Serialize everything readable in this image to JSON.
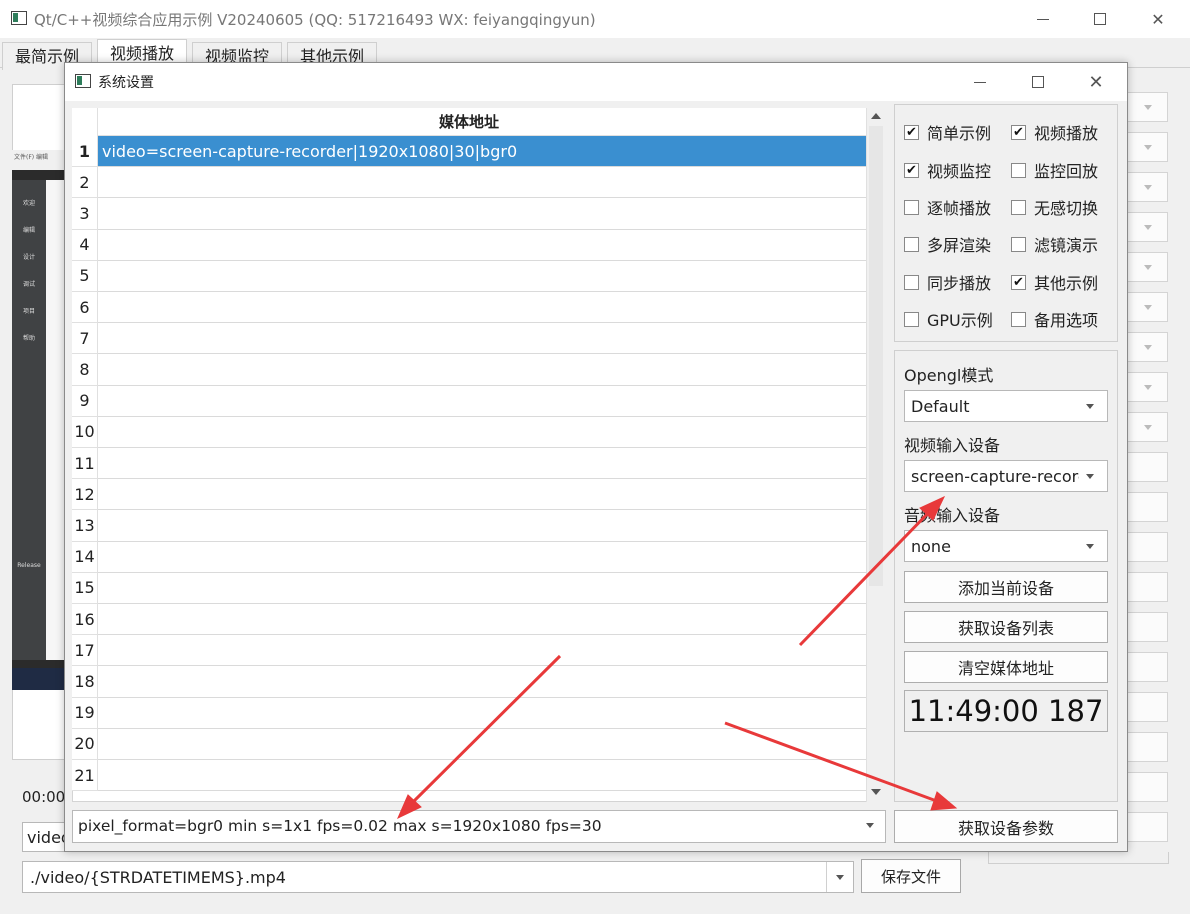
{
  "main_window": {
    "title": "Qt/C++视频综合应用示例 V20240605 (QQ: 517216493 WX: feiyangqingyun)",
    "tabs": [
      {
        "label": "最简示例"
      },
      {
        "label": "视频播放"
      },
      {
        "label": "视频监控"
      },
      {
        "label": "其他示例"
      }
    ],
    "active_tab": "视频播放",
    "time_label": "00:00",
    "left_combo_value": "video",
    "save_path": "./video/{STRDATETIMEMS}.mp4",
    "save_button": "保存文件",
    "preview_menu": "文件(F)  编辑",
    "preview_sidebar": [
      "欢迎",
      "编辑",
      "设计",
      "调试",
      "项目",
      "帮助"
    ],
    "preview_release": "Release"
  },
  "dialog": {
    "title": "系统设置",
    "table": {
      "column_header": "媒体地址",
      "rows": [
        {
          "num": "1",
          "value": "video=screen-capture-recorder|1920x1080|30|bgr0",
          "selected": true
        },
        {
          "num": "2",
          "value": ""
        },
        {
          "num": "3",
          "value": ""
        },
        {
          "num": "4",
          "value": ""
        },
        {
          "num": "5",
          "value": ""
        },
        {
          "num": "6",
          "value": ""
        },
        {
          "num": "7",
          "value": ""
        },
        {
          "num": "8",
          "value": ""
        },
        {
          "num": "9",
          "value": ""
        },
        {
          "num": "10",
          "value": ""
        },
        {
          "num": "11",
          "value": ""
        },
        {
          "num": "12",
          "value": ""
        },
        {
          "num": "13",
          "value": ""
        },
        {
          "num": "14",
          "value": ""
        },
        {
          "num": "15",
          "value": ""
        },
        {
          "num": "16",
          "value": ""
        },
        {
          "num": "17",
          "value": ""
        },
        {
          "num": "18",
          "value": ""
        },
        {
          "num": "19",
          "value": ""
        },
        {
          "num": "20",
          "value": ""
        },
        {
          "num": "21",
          "value": ""
        }
      ]
    },
    "checkboxes": [
      {
        "label": "简单示例",
        "checked": true
      },
      {
        "label": "视频播放",
        "checked": true
      },
      {
        "label": "视频监控",
        "checked": true
      },
      {
        "label": "监控回放",
        "checked": false
      },
      {
        "label": "逐帧播放",
        "checked": false
      },
      {
        "label": "无感切换",
        "checked": false
      },
      {
        "label": "多屏渲染",
        "checked": false
      },
      {
        "label": "滤镜演示",
        "checked": false
      },
      {
        "label": "同步播放",
        "checked": false
      },
      {
        "label": "其他示例",
        "checked": true
      },
      {
        "label": "GPU示例",
        "checked": false
      },
      {
        "label": "备用选项",
        "checked": false
      }
    ],
    "opengl_label": "Opengl模式",
    "opengl_value": "Default",
    "video_device_label": "视频输入设备",
    "video_device_value": "screen-capture-recorder",
    "audio_device_label": "音频输入设备",
    "audio_device_value": "none",
    "btn_add_device": "添加当前设备",
    "btn_get_devices": "获取设备列表",
    "btn_clear_urls": "清空媒体地址",
    "clock": "11:49:00 187",
    "device_params": "pixel_format=bgr0 min s=1x1 fps=0.02 max s=1920x1080 fps=30",
    "btn_get_params": "获取设备参数"
  },
  "colors": {
    "selection": "#3a8fd0",
    "annotation_arrow": "#e8393a"
  },
  "icons": [
    "app-icon",
    "minimize-icon",
    "maximize-icon",
    "close-icon",
    "chevron-down-icon",
    "scroll-up-icon",
    "scroll-down-icon",
    "check-icon"
  ]
}
